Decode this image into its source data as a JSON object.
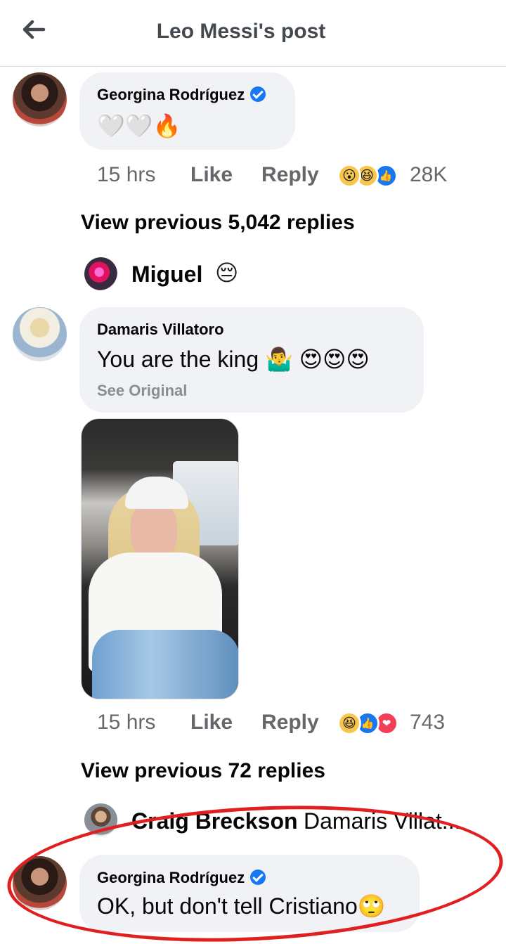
{
  "header": {
    "back_icon": "arrow-left-icon",
    "title": "Leo Messi's post"
  },
  "comments": [
    {
      "author": "Georgina Rodríguez",
      "verified": true,
      "text": "🤍🤍🔥",
      "time": "15 hrs",
      "like_label": "Like",
      "reply_label": "Reply",
      "reactions": [
        "wow",
        "haha",
        "like"
      ],
      "reaction_count": "28K"
    },
    {
      "author": "Damaris Villatoro",
      "verified": false,
      "text": "You are the king 🤷‍♂️ 😍😍😍",
      "see_original": "See Original",
      "has_photo": true,
      "time": "15 hrs",
      "like_label": "Like",
      "reply_label": "Reply",
      "reactions": [
        "haha",
        "like",
        "love"
      ],
      "reaction_count": "743"
    },
    {
      "author": "Georgina Rodríguez",
      "verified": true,
      "text": "OK, but don't tell Cristiano🙄"
    }
  ],
  "view_previous": [
    "View previous 5,042 replies",
    "View previous 72 replies"
  ],
  "collapsed_replies": [
    {
      "name": "Miguel",
      "preview": "😔"
    },
    {
      "name": "Craig Breckson",
      "preview": "Damaris Villat..."
    }
  ],
  "annotation": {
    "color": "#e02020",
    "shape": "ellipse"
  }
}
